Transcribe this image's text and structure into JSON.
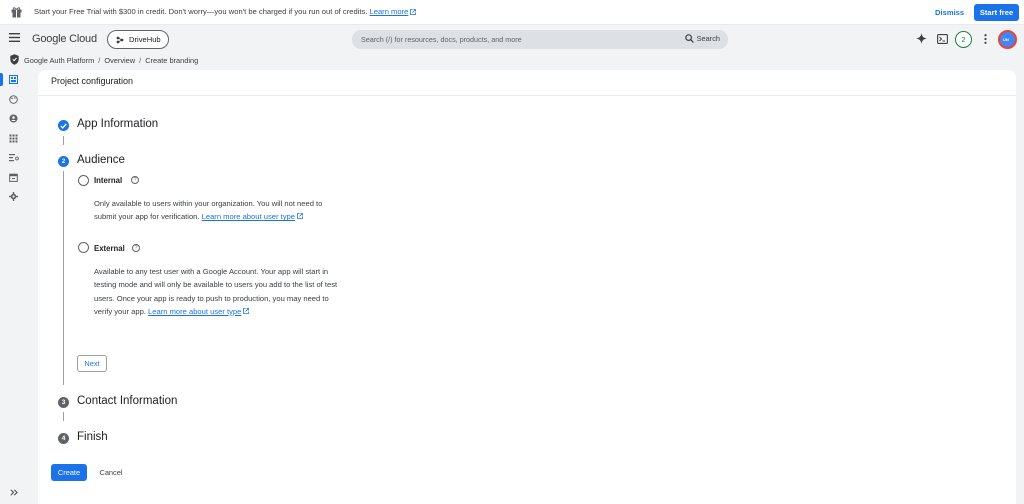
{
  "banner": {
    "text": "Start your Free Trial with $300 in credit. Don't worry—you won't be charged if you run out of credits.",
    "learn_more": "Learn more",
    "dismiss": "Dismiss",
    "start_free": "Start free"
  },
  "header": {
    "logo": "Google Cloud",
    "project": "DriveHub",
    "search_placeholder": "Search (/) for resources, docs, products, and more",
    "search_button": "Search",
    "notification_count": "2",
    "avatar_initials": "UN"
  },
  "breadcrumb": {
    "items": [
      "Google Auth Platform",
      "Overview",
      "Create branding"
    ],
    "separator": "/"
  },
  "page": {
    "title": "Project configuration"
  },
  "steps": [
    {
      "number": "✓",
      "label": "App Information",
      "state": "completed"
    },
    {
      "number": "2",
      "label": "Audience",
      "state": "active"
    },
    {
      "number": "3",
      "label": "Contact Information",
      "state": "pending"
    },
    {
      "number": "4",
      "label": "Finish",
      "state": "pending"
    }
  ],
  "audience": {
    "internal": {
      "label": "Internal",
      "description": "Only available to users within your organization. You will not need to submit your app for verification.",
      "link_line1": "Learn more about",
      "link_line2": "user type"
    },
    "external": {
      "label": "External",
      "description": "Available to any test user with a Google Account. Your app will start in testing mode and will only be available to users you add to the list of test users. Once your app is ready to push to production, you may need to verify your app.",
      "link_line1": "Learn more about",
      "link_line2": "user type"
    },
    "next_button": "Next"
  },
  "actions": {
    "create": "Create",
    "cancel": "Cancel"
  },
  "colors": {
    "accent": "#1a73e8",
    "completed": "#1a73e8",
    "pending": "#5f6368",
    "badge": "#188038"
  },
  "icons": [
    "gift-icon",
    "menu-icon",
    "project-icon",
    "search-icon",
    "gemini-icon",
    "cloud-shell-icon",
    "more-vert-icon",
    "shield-icon",
    "dashboard-icon",
    "palette-icon",
    "person-icon",
    "grid-icon",
    "filter-icon",
    "calendar-icon",
    "settings-icon",
    "help-icon",
    "external-link-icon",
    "expand-icon"
  ]
}
